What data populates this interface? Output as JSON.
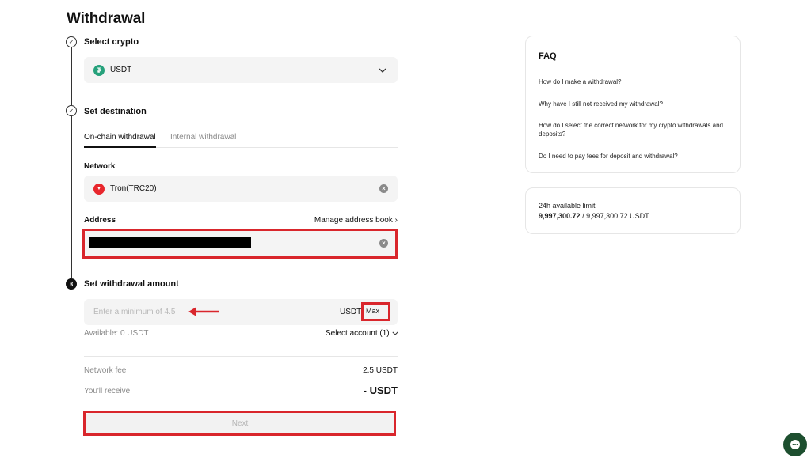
{
  "page": {
    "title": "Withdrawal"
  },
  "steps": {
    "crypto": {
      "title": "Select crypto",
      "selected_coin": "USDT"
    },
    "destination": {
      "title": "Set destination",
      "tabs": [
        "On-chain withdrawal",
        "Internal withdrawal"
      ],
      "network_label": "Network",
      "network_value": "Tron(TRC20)",
      "address_label": "Address",
      "manage_link": "Manage address book"
    },
    "amount": {
      "number": "3",
      "title": "Set withdrawal amount",
      "placeholder": "Enter a minimum of 4.5",
      "unit": "USDT",
      "max_label": "Max",
      "available": "Available: 0 USDT",
      "select_account": "Select account (1)"
    }
  },
  "summary": {
    "fee_label": "Network fee",
    "fee_value": "2.5 USDT",
    "receive_label": "You'll receive",
    "receive_value": "- USDT"
  },
  "next_label": "Next",
  "faq": {
    "title": "FAQ",
    "questions": [
      "How do I make a withdrawal?",
      "Why have I still not received my withdrawal?",
      "How do I select the correct network for my crypto withdrawals and deposits?",
      "Do I need to pay fees for deposit and withdrawal?"
    ]
  },
  "limit": {
    "label": "24h available limit",
    "used": "9,997,300.72",
    "total": " / 9,997,300.72 USDT"
  },
  "icons": {
    "check": "check-icon",
    "coin": "usdt-icon",
    "network": "tron-icon",
    "chevron": "chevron-down-icon",
    "clear": "clear-icon",
    "arrow": "red-arrow-icon",
    "chat": "chat-icon"
  },
  "colors": {
    "highlight": "#d9262c",
    "usdt": "#26a17b",
    "tron": "#e8272d",
    "chat": "#1d4f2f"
  }
}
